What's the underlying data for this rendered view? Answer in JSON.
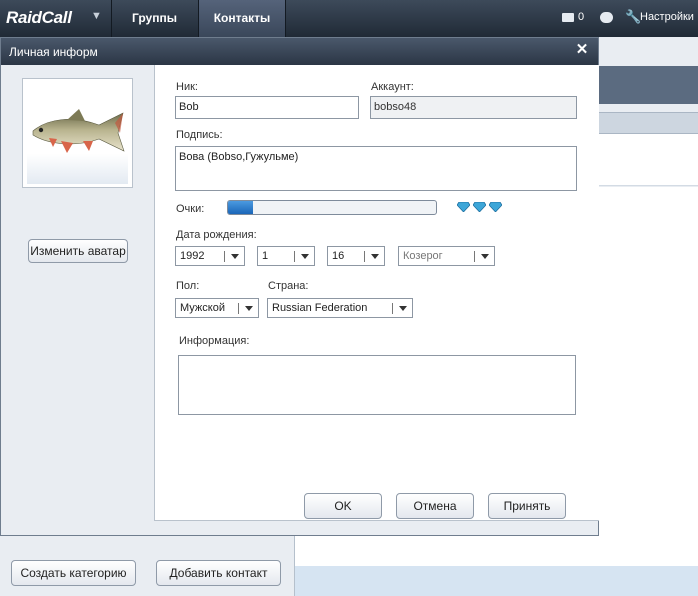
{
  "app": {
    "logo": "RaidCall",
    "nav": {
      "groups": "Группы",
      "contacts": "Контакты"
    },
    "mail_count": "0",
    "settings": "Настройки"
  },
  "dialog": {
    "title": "Личная информ",
    "change_avatar": "Изменить аватар",
    "nick_label": "Ник:",
    "nick_value": "Bob",
    "account_label": "Аккаунт:",
    "account_value": "bobso48",
    "signature_label": "Подпись:",
    "signature_value": "Вова (Bobso,Гужульме)",
    "points_label": "Очки:",
    "points_progress": 0.12,
    "birth_label": "Дата рождения:",
    "birth_year": "1992",
    "birth_month": "1",
    "birth_day": "16",
    "zodiac": "Козерог",
    "gender_label": "Пол:",
    "gender_value": "Мужской",
    "country_label": "Страна:",
    "country_value": "Russian Federation",
    "info_label": "Информация:",
    "info_value": "",
    "ok": "OK",
    "cancel": "Отмена",
    "apply": "Принять"
  },
  "bottom": {
    "create_category": "Создать категорию",
    "add_contact": "Добавить  контакт"
  }
}
